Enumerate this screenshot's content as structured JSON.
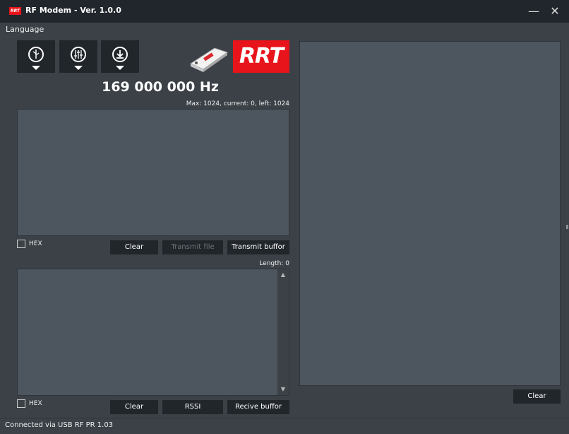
{
  "window": {
    "logo_text": "RRT",
    "title": "RF Modem - Ver. 1.0.0",
    "minimize_glyph": "—",
    "close_glyph": "✕"
  },
  "menu": {
    "language": "Language"
  },
  "toolbar": {
    "buttons": [
      {
        "icon": "usb-connect-icon"
      },
      {
        "icon": "settings-sliders-icon"
      },
      {
        "icon": "download-icon"
      }
    ]
  },
  "brand": {
    "logo_text": "RRT",
    "accent": "#e8141b"
  },
  "frequency": "169 000 000 Hz",
  "transmit": {
    "limits": "Max: 1024, current: 0, left: 1024",
    "hex_label": "HEX",
    "clear_label": "Clear",
    "transmit_file_label": "Transmit file",
    "transmit_buffer_label": "Transmit buffor"
  },
  "receive": {
    "length": "Length: 0",
    "hex_label": "HEX",
    "clear_label": "Clear",
    "rssi_label": "RSSI",
    "receive_buffer_label": "Recive buffor",
    "scroll_up": "▲",
    "scroll_down": "▼"
  },
  "log": {
    "clear_label": "Clear"
  },
  "status": {
    "text": "Connected via USB RF PR 1.03"
  },
  "colors": {
    "background": "#3b4147",
    "titlebar": "#20262b",
    "textbox": "#4d565f",
    "button": "#21262b"
  }
}
